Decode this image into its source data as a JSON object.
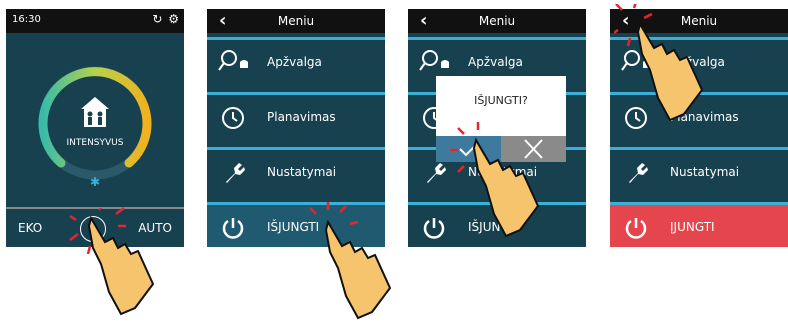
{
  "screen1": {
    "time": "16:30",
    "status_icons": "↻ ⚙",
    "mode_label": "INTENSYVUS",
    "bottom": {
      "left": "EKO",
      "right": "AUTO"
    }
  },
  "menu": {
    "title": "Meniu",
    "items": [
      {
        "label": "Apžvalga",
        "icon": "lamp-icon"
      },
      {
        "label": "Planavimas",
        "icon": "clock-icon"
      },
      {
        "label": "Nustatymai",
        "icon": "wrench-icon"
      },
      {
        "label": "IŠJUNGTI",
        "icon": "power-icon"
      }
    ],
    "on_label": "ĮJUNGTI"
  },
  "dialog": {
    "question": "IŠJUNGTI?"
  },
  "colors": {
    "screen_bg": "#184150",
    "accent": "#3ab0d9",
    "on_red": "#e5454c",
    "topbar": "#111111"
  }
}
